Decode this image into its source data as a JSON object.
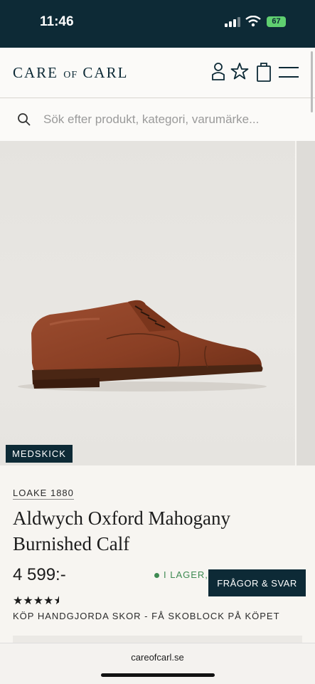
{
  "status": {
    "time": "11:46",
    "battery": "67"
  },
  "header": {
    "logo_main_1": "CARE",
    "logo_of": "OF",
    "logo_main_2": "CARL"
  },
  "search": {
    "placeholder": "Sök efter produkt, kategori, varumärke..."
  },
  "product": {
    "tag": "MEDSKICK",
    "brand": "LOAKE 1880",
    "title": "Aldwych Oxford Mahogany Burnished Calf",
    "price": "4 599:-",
    "stock": "I LAGER,",
    "faq_label": "FRÅGOR & SVAR",
    "stars": "★★★★",
    "rating": 4.5,
    "promo": "KÖP HANDGJORDA SKOR - FÅ SKOBLOCK PÅ KÖPET"
  },
  "browser": {
    "url": "careofcarl.se"
  },
  "colors": {
    "brand_navy": "#0d2a36",
    "stock_green": "#3e8a52",
    "shoe": "#8b4228"
  }
}
